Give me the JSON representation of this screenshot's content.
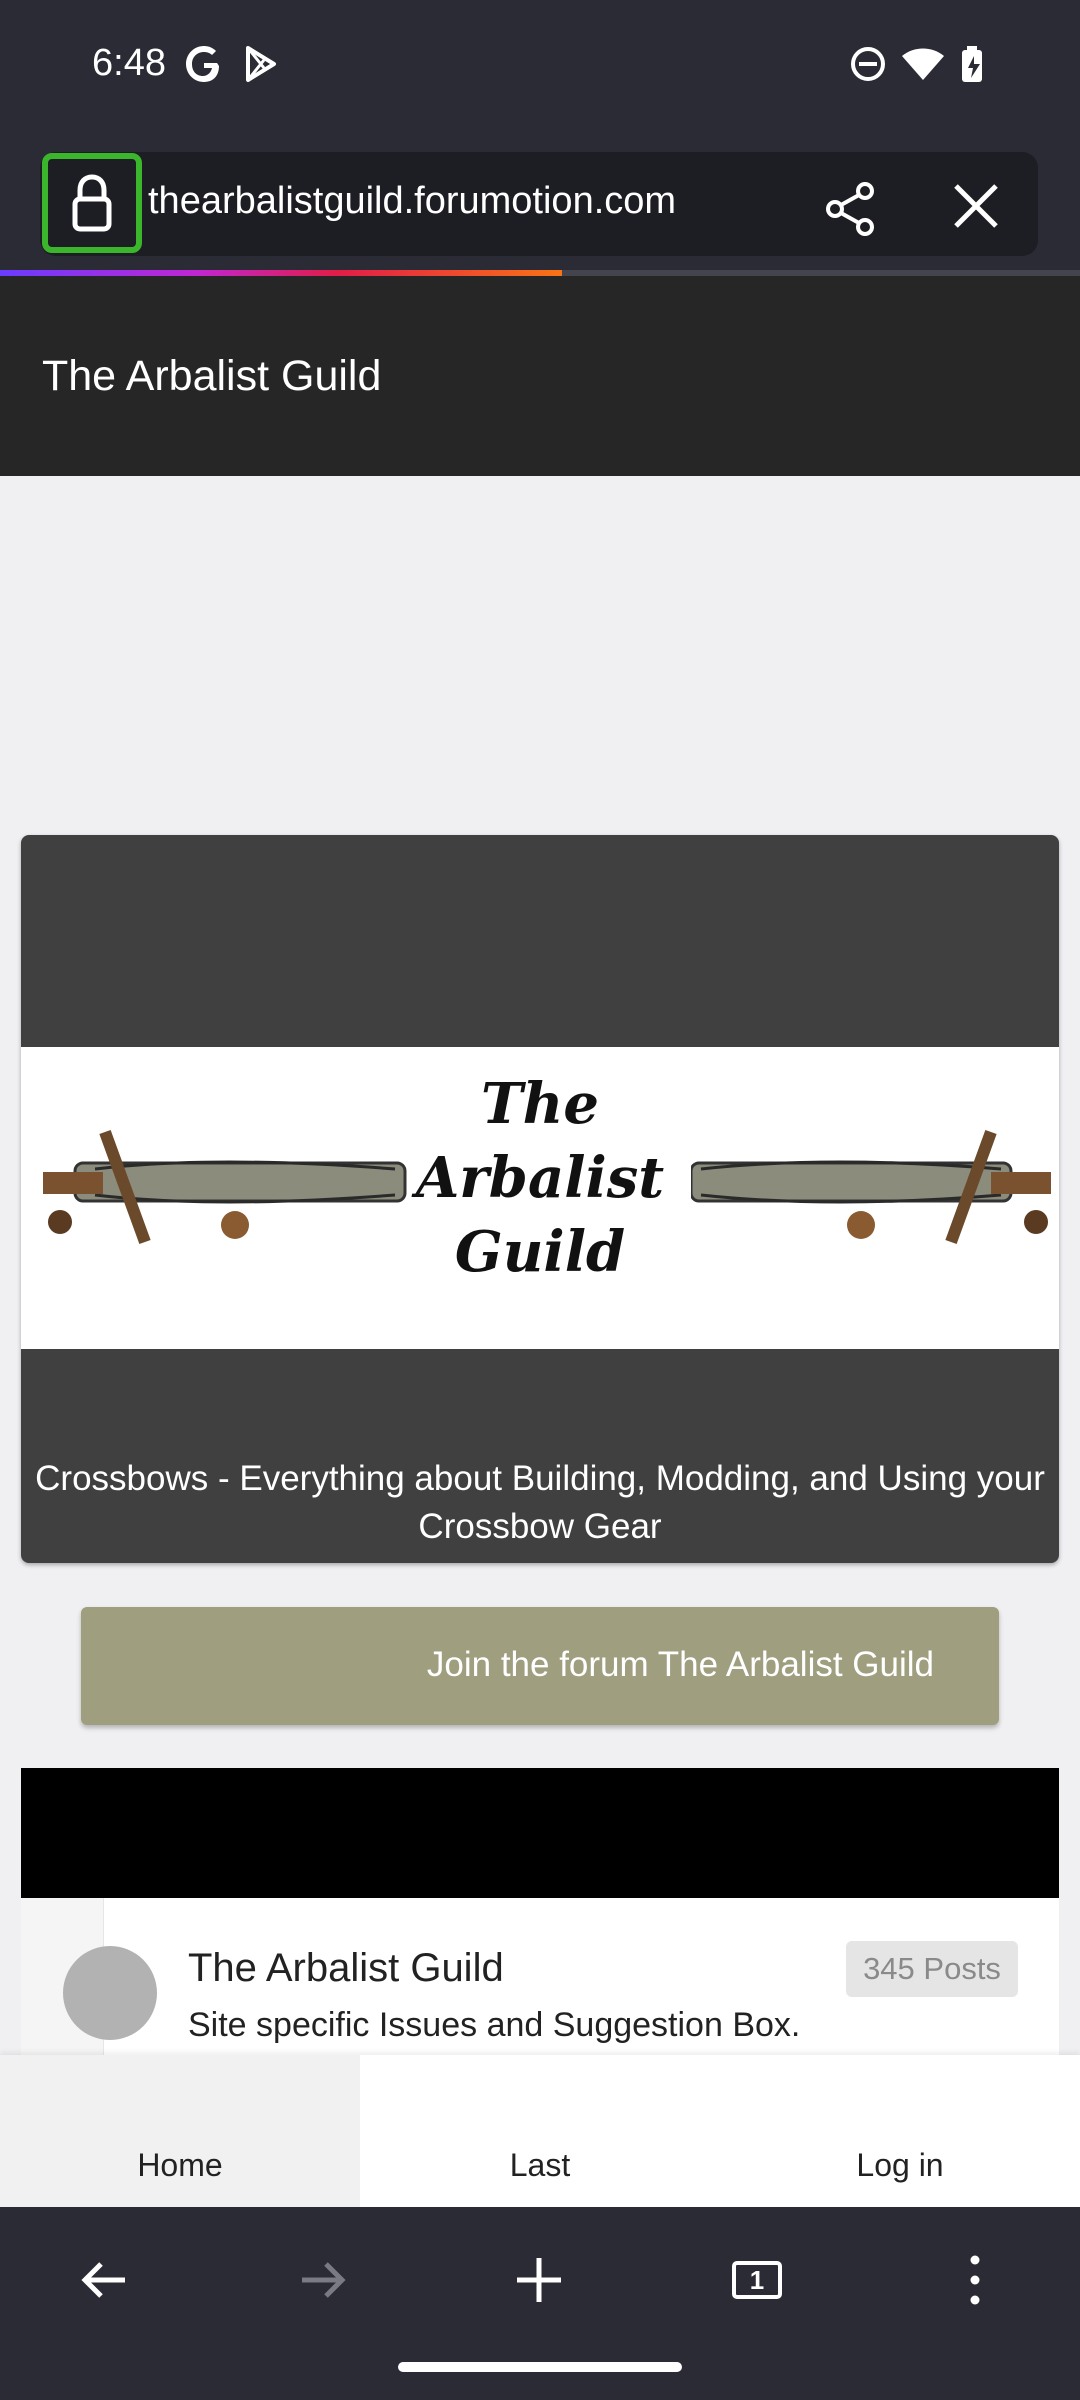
{
  "status_bar": {
    "time": "6:48",
    "left_icons": [
      "google-g-icon",
      "play-store-icon"
    ],
    "right_icons": [
      "do-not-disturb-icon",
      "wifi-icon",
      "battery-icon"
    ]
  },
  "browser": {
    "url": "thearbalistguild.forumotion.com",
    "lock_icon": "lock-icon",
    "share_icon": "share-icon",
    "close_icon": "close-icon",
    "progress": 0.52,
    "accent_color": "#3bb52b"
  },
  "site": {
    "title": "The Arbalist Guild",
    "banner_logo_lines": [
      "The",
      "Arbalist",
      "Guild"
    ],
    "banner_tagline": "Crossbows - Everything about Building, Modding, and Using your Crossbow Gear",
    "join_button": "Join the forum The Arbalist Guild"
  },
  "category": {
    "title": "The Arbalist Guild",
    "description": "Site specific Issues and Suggestion Box.",
    "posts_badge": "345 Posts"
  },
  "forum_nav": {
    "home": "Home",
    "last": "Last",
    "login": "Log in"
  },
  "toolbar": {
    "tab_count": "1",
    "icons": [
      "back-arrow-icon",
      "forward-arrow-icon",
      "new-tab-icon",
      "tabs-icon",
      "menu-icon"
    ]
  }
}
